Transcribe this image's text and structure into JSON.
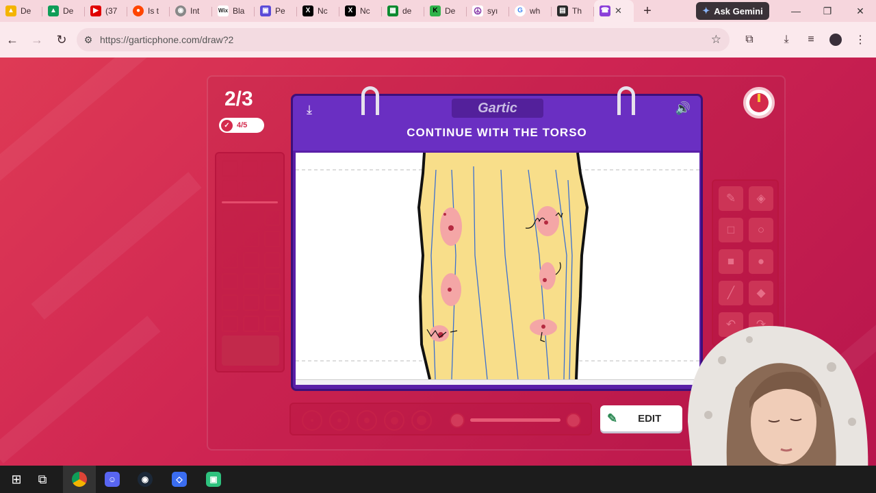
{
  "browser": {
    "tabs": [
      {
        "label": "De",
        "icon": "google-drive-icon",
        "color": "#f4b400"
      },
      {
        "label": "De",
        "icon": "google-drive-icon",
        "color": "#0f9d58"
      },
      {
        "label": "(37",
        "icon": "youtube-icon",
        "color": "#e00000"
      },
      {
        "label": "Is t",
        "icon": "reddit-icon",
        "color": "#ff4500"
      },
      {
        "label": "Int",
        "icon": "globe-icon",
        "color": "#666666"
      },
      {
        "label": "Bla",
        "icon": "wix-icon",
        "color": "#222222"
      },
      {
        "label": "Pe",
        "icon": "app-icon",
        "color": "#5b4bd8"
      },
      {
        "label": "Nc",
        "icon": "x-icon",
        "color": "#000000"
      },
      {
        "label": "Nc",
        "icon": "x-icon",
        "color": "#000000"
      },
      {
        "label": "de",
        "icon": "grid-icon",
        "color": "#0b8a2f"
      },
      {
        "label": "De",
        "icon": "k-icon",
        "color": "#2fb34a"
      },
      {
        "label": "syı",
        "icon": "peace-icon",
        "color": "#8e44ad"
      },
      {
        "label": "wh",
        "icon": "google-icon",
        "color": "#4285f4"
      },
      {
        "label": "Th",
        "icon": "film-icon",
        "color": "#2a2a2a"
      }
    ],
    "active_tab_icon": "phone-icon",
    "gemini_label": "Ask Gemini",
    "url": "https://garticphone.com/draw?2"
  },
  "game": {
    "round": "2/3",
    "done_count": "4/5",
    "logo": "Gartic",
    "prompt": "CONTINUE WITH THE TORSO",
    "edit_label": "EDIT",
    "timer_remaining_fraction": 0.95,
    "accent_color": "#d42a4c",
    "board_color": "#5a1fa8"
  },
  "taskbar": {
    "apps": [
      "windows-icon",
      "task-view-icon",
      "chrome-icon",
      "discord-icon",
      "steam-icon",
      "roblox-icon",
      "app-icon"
    ]
  }
}
